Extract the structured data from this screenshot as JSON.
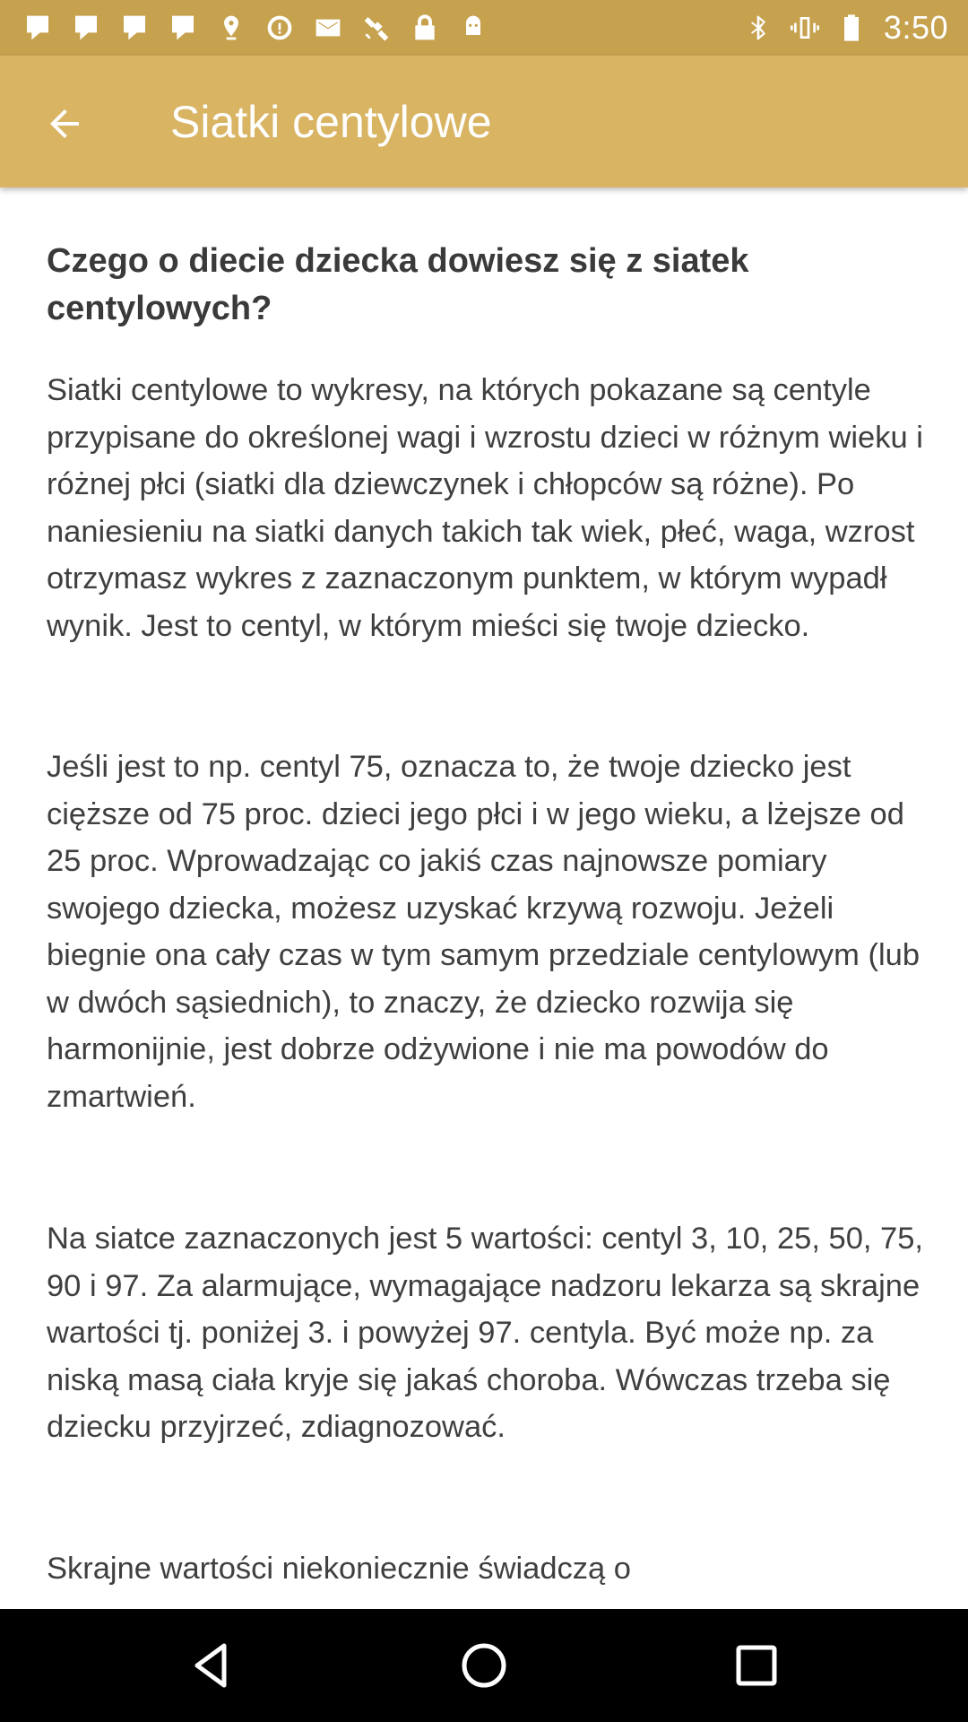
{
  "status_bar": {
    "time": "3:50",
    "left_icons": [
      "notification-icon",
      "notification-icon",
      "notification-icon",
      "notification-icon",
      "location-pin-icon",
      "sync-icon",
      "email-icon",
      "satellite-icon",
      "lock-icon",
      "android-icon"
    ],
    "right_icons": [
      "bluetooth-icon",
      "vibrate-icon",
      "battery-icon"
    ]
  },
  "app_bar": {
    "title": "Siatki centylowe",
    "back_icon": "arrow-left-icon"
  },
  "article": {
    "heading": "Czego o diecie dziecka dowiesz się z siatek centylowych?",
    "paragraphs": [
      "Siatki centylowe to wykresy, na których pokazane są centyle przypisane do określonej wagi i wzrostu dzieci w różnym wieku i różnej płci (siatki dla dziewczynek i chłopców są różne). Po naniesieniu na siatki danych takich tak wiek, płeć, waga, wzrost otrzymasz wykres z zaznaczonym punktem, w którym wypadł wynik. Jest to centyl, w którym mieści się twoje dziecko.",
      "Jeśli jest to np. centyl 75, oznacza to, że twoje dziecko jest cięższe od 75 proc. dzieci jego płci i w jego wieku, a lżejsze od 25 proc. Wprowadzając co jakiś czas najnowsze pomiary swojego dziecka, możesz uzyskać krzywą rozwoju. Jeżeli biegnie ona cały czas w tym samym przedziale centylowym (lub w dwóch sąsiednich), to znaczy, że dziecko rozwija się harmonijnie, jest dobrze odżywione i nie ma powodów do zmartwień.",
      "Na siatce zaznaczonych jest 5 wartości: centyl 3, 10, 25, 50, 75, 90 i 97. Za alarmujące, wymagające nadzoru lekarza są skrajne wartości tj. poniżej 3. i powyżej 97. centyla. Być może np. za niską masą ciała kryje się jakaś choroba. Wówczas trzeba się dziecku przyjrzeć, zdiagnozować.",
      "Skrajne wartości niekoniecznie świadczą o"
    ]
  },
  "nav_bar": {
    "icons": [
      "back-triangle-icon",
      "home-circle-icon",
      "recents-square-icon"
    ]
  },
  "colors": {
    "status_bar": "#c6a24f",
    "app_bar": "#d8b463",
    "nav_bar": "#000000"
  }
}
